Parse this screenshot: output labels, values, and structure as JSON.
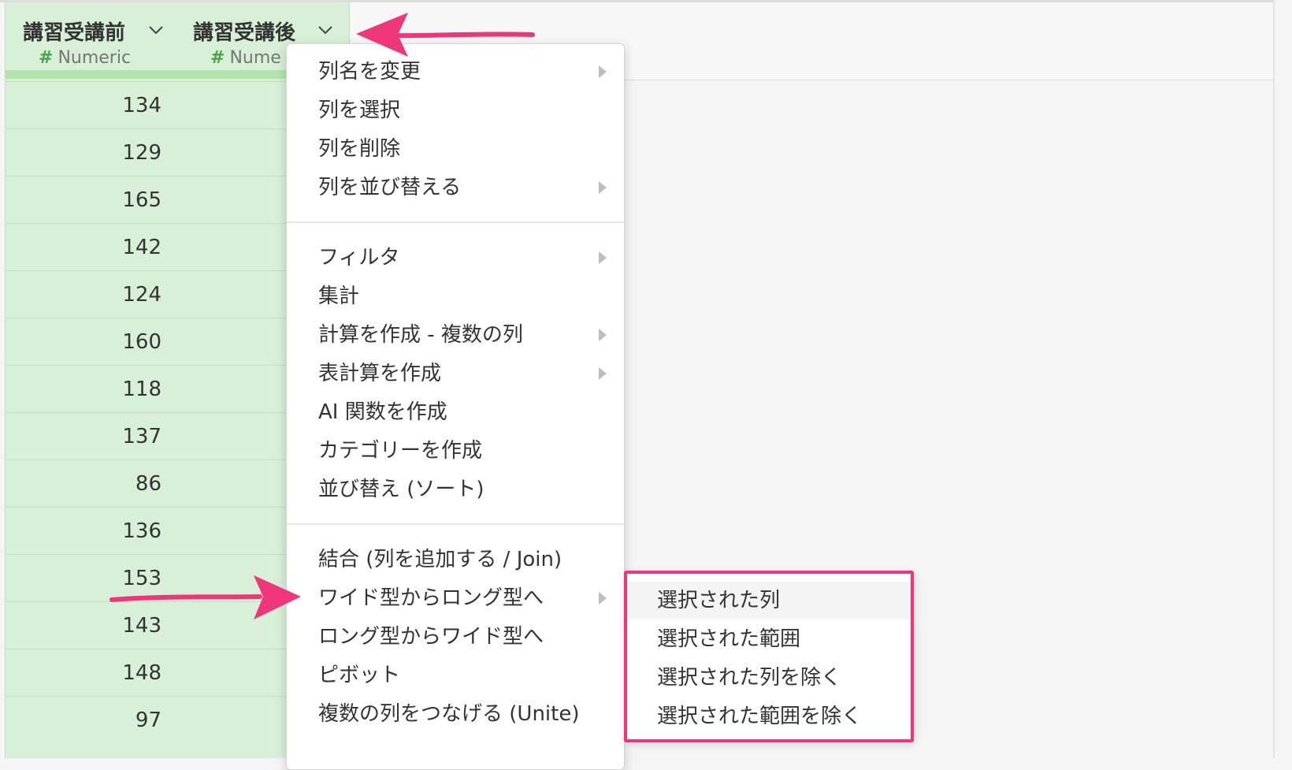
{
  "columns": [
    {
      "title": "講習受講前",
      "type_label": "Numeric",
      "values": [
        "134",
        "129",
        "165",
        "142",
        "124",
        "160",
        "118",
        "137",
        "86",
        "136",
        "153",
        "143",
        "148",
        "97"
      ]
    },
    {
      "title": "講習受講後",
      "type_label": "Nume"
    }
  ],
  "type_icon": "#",
  "menu": {
    "groups": [
      [
        {
          "label": "列名を変更",
          "submenu": true
        },
        {
          "label": "列を選択",
          "submenu": false
        },
        {
          "label": "列を削除",
          "submenu": false
        },
        {
          "label": "列を並び替える",
          "submenu": true
        }
      ],
      [
        {
          "label": "フィルタ",
          "submenu": true
        },
        {
          "label": "集計",
          "submenu": false
        },
        {
          "label": "計算を作成 - 複数の列",
          "submenu": true
        },
        {
          "label": "表計算を作成",
          "submenu": true
        },
        {
          "label": "AI 関数を作成",
          "submenu": false
        },
        {
          "label": "カテゴリーを作成",
          "submenu": false
        },
        {
          "label": "並び替え (ソート)",
          "submenu": false
        }
      ],
      [
        {
          "label": "結合 (列を追加する / Join)",
          "submenu": false
        },
        {
          "label": "ワイド型からロング型へ",
          "submenu": true
        },
        {
          "label": "ロング型からワイド型へ",
          "submenu": false
        },
        {
          "label": "ピボット",
          "submenu": false
        },
        {
          "label": "複数の列をつなげる (Unite)",
          "submenu": false
        }
      ]
    ]
  },
  "submenu": {
    "items": [
      "選択された列",
      "選択された範囲",
      "選択された列を除く",
      "選択された範囲を除く"
    ],
    "highlighted_index": 0
  },
  "colors": {
    "column_bg": "#d9f0d8",
    "column_bar": "#b2e5ac",
    "annotation": "#f0367a",
    "numeric_icon": "#4aa44a"
  }
}
